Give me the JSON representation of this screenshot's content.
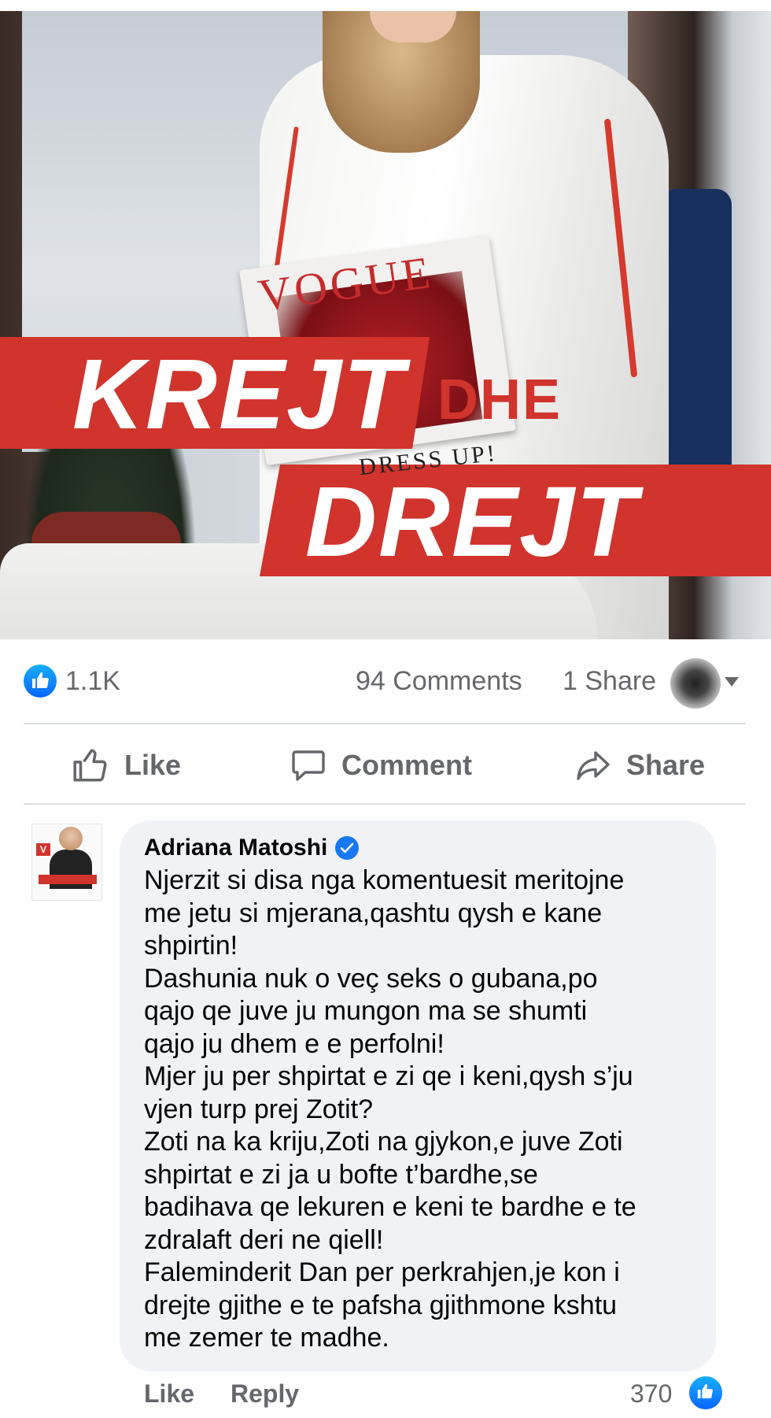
{
  "post": {
    "banner_word_1": "KREJT",
    "banner_word_small": "DHE",
    "banner_word_2": "DREJT",
    "magazine_title": "VOGUE",
    "magazine_caption": "DRESS UP!"
  },
  "stats": {
    "reactions": "1.1K",
    "comments": "94 Comments",
    "shares": "1 Share"
  },
  "actions": {
    "like": "Like",
    "comment": "Comment",
    "share": "Share"
  },
  "comment": {
    "author": "Adriana Matoshi",
    "lines": [
      "Njerzit si disa nga komentuesit meritojne",
      "me jetu si mjerana,qashtu qysh e kane",
      "shpirtin!",
      "Dashunia nuk o veç seks o gubana,po",
      "qajo qe juve ju mungon ma se shumti",
      "qajo ju dhem e e perfolni!",
      "Mjer ju per shpirtat e zi qe i keni,qysh s’ju",
      "vjen turp prej Zotit?",
      "Zoti na ka kriju,Zoti na gjykon,e juve Zoti",
      "shpirtat e zi ja u bofte t’bardhe,se",
      "badihava qe lekuren e keni te bardhe e te",
      "zdralaft deri ne qiell!",
      "Faleminderit Dan per perkrahjen,je kon i",
      "drejte gjithe e te pafsha gjithmone kshtu",
      "me zemer te madhe."
    ],
    "like_label": "Like",
    "reply_label": "Reply",
    "reaction_count": "370"
  },
  "colors": {
    "facebook_blue": "#1877f2",
    "banner_red": "#d0342c",
    "muted_text": "#65676b",
    "bubble_bg": "#f0f2f5"
  },
  "icons": {
    "reaction": "like-thumb-icon",
    "like_action": "thumbs-up-outline-icon",
    "comment_action": "speech-bubble-icon",
    "share_action": "share-arrow-icon",
    "verified": "verified-badge-icon",
    "audience": "chevron-down-icon"
  }
}
